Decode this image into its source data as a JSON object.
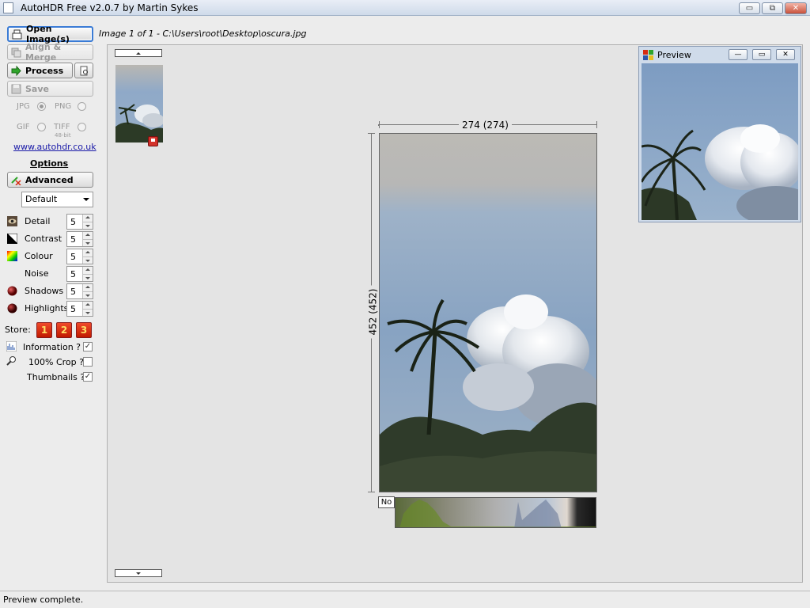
{
  "window": {
    "title": "AutoHDR Free v2.0.7 by Martin Sykes",
    "min_label": "▭",
    "max_label": "⧉",
    "close_label": "✕"
  },
  "toolbar": {
    "open_label": "Open Image(s)",
    "align_label": "Align & Merge",
    "process_label": "Process",
    "save_label": "Save"
  },
  "formats": {
    "jpg": "JPG",
    "png": "PNG",
    "gif": "GIF",
    "tiff": "TIFF",
    "tiff_sub": "48-bit",
    "selected": "JPG"
  },
  "website": "www.autohdr.co.uk",
  "options": {
    "header": "Options",
    "advanced_label": "Advanced",
    "preset": "Default",
    "sliders": [
      {
        "name": "Detail",
        "value": "5",
        "icon": "eye-icon"
      },
      {
        "name": "Contrast",
        "value": "5",
        "icon": "contrast-icon"
      },
      {
        "name": "Colour",
        "value": "5",
        "icon": "colour-icon"
      },
      {
        "name": "Noise",
        "value": "5",
        "icon": ""
      },
      {
        "name": "Shadows",
        "value": "5",
        "icon": "shadows-icon"
      },
      {
        "name": "Highlights",
        "value": "5",
        "icon": "highlights-icon"
      }
    ],
    "store_label": "Store:",
    "store_slots": [
      "1",
      "2",
      "3"
    ],
    "information_label": "Information ?",
    "information_checked": true,
    "crop_label": "100% Crop ?",
    "crop_checked": false,
    "thumbnails_label": "Thumbnails ?",
    "thumbnails_checked": true
  },
  "image": {
    "path_label": "Image 1 of 1 - C:\\Users\\root\\Desktop\\oscura.jpg",
    "width_label": "274 (274)",
    "height_label": "452 (452)",
    "histogram_toggle": "No"
  },
  "preview": {
    "title": "Preview"
  },
  "status": {
    "text": "Preview complete."
  },
  "colors": {
    "accent": "#3a7bd5",
    "store_red": "#d42a10",
    "sky": "#8fa8c4"
  }
}
